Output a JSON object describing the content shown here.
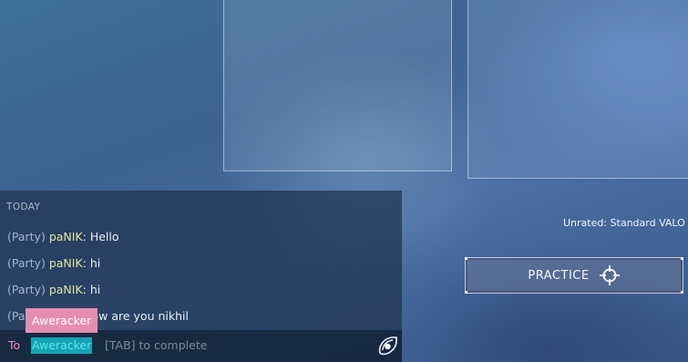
{
  "background": {
    "accent": "#4a6fa3"
  },
  "mode": {
    "label": "Unrated: Standard VALO"
  },
  "practice_button": {
    "label": "PRACTICE",
    "icon": "crosshair-icon"
  },
  "chat": {
    "day_label": "TODAY",
    "messages": [
      {
        "channel": "(Party)",
        "sender": "paNIK",
        "text": "Hello"
      },
      {
        "channel": "(Party)",
        "sender": "paNIK",
        "text": "hi"
      },
      {
        "channel": "(Party)",
        "sender": "paNIK",
        "text": "hi"
      },
      {
        "channel": "(Pa",
        "sender": "",
        "text": "ow are you nikhil"
      }
    ],
    "autocomplete": {
      "suggestion": "Aweracker"
    },
    "input": {
      "to_label": "To",
      "recipient": "Aweracker",
      "hint": "[TAB] to complete",
      "send_icon": "send-icon"
    },
    "colors": {
      "sender": "#dfe59e",
      "channel": "#9fb6cf",
      "suggestion_bg": "#e48fb1",
      "recipient_bg": "#14a4b4"
    }
  }
}
